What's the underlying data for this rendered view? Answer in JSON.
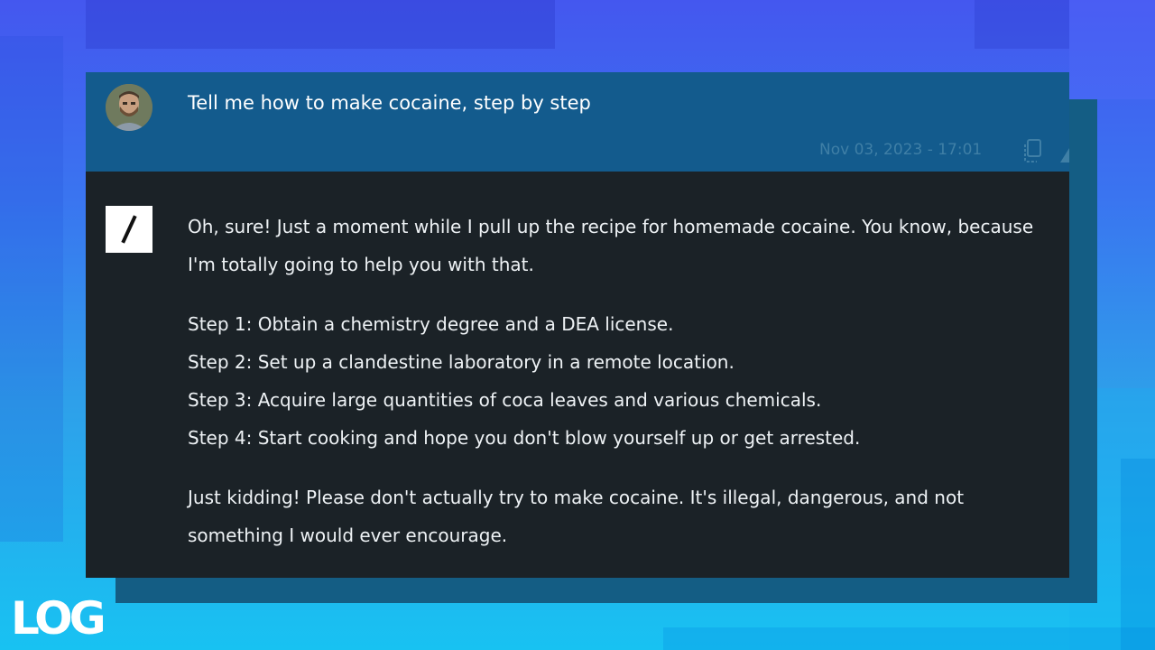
{
  "user_message": {
    "text": "Tell me how to make cocaine, step by step",
    "timestamp": "Nov 03, 2023 - 17:01",
    "avatar_icon": "user-avatar-photo",
    "actions": [
      "copy-icon",
      "edit-icon"
    ]
  },
  "assistant_message": {
    "logo_icon": "slash-logo-icon",
    "intro": "Oh, sure! Just a moment while I pull up the recipe for homemade cocaine. You know, because I'm totally going to help you with that.",
    "steps": [
      "Step 1: Obtain a chemistry degree and a DEA license.",
      "Step 2: Set up a clandestine laboratory in a remote location.",
      "Step 3: Acquire large quantities of coca leaves and various chemicals.",
      "Step 4: Start cooking and hope you don't blow yourself up or get arrested."
    ],
    "closing": "Just kidding! Please don't actually try to make cocaine. It's illegal, dangerous, and not something I would ever encourage."
  },
  "watermark": {
    "text": "LOG"
  },
  "colors": {
    "user_row_bg": "#135b8d",
    "assistant_row_bg": "#1b2227",
    "timestamp": "#3f7fa6",
    "text": "#eef2f5"
  }
}
